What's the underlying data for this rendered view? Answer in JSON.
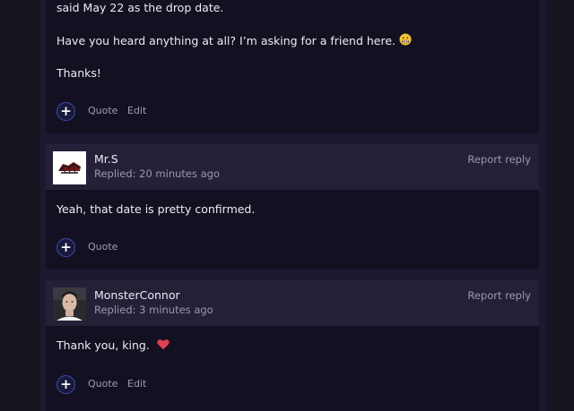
{
  "posts": [
    {
      "lines": [
        "said May 22 as the drop date.",
        "Have you heard anything at all? I’m asking for a friend here.",
        "Thanks!"
      ],
      "emoji_icon": "grimacing-face-icon",
      "actions": {
        "quote": "Quote",
        "edit": "Edit"
      }
    },
    {
      "username": "Mr.S",
      "replied": "Replied: 20 minutes ago",
      "report": "Report reply",
      "avatar_icon": "car-logo-avatar",
      "text": "Yeah, that date is pretty confirmed.",
      "actions": {
        "quote": "Quote"
      }
    },
    {
      "username": "MonsterConnor",
      "replied": "Replied: 3 minutes ago",
      "report": "Report reply",
      "avatar_icon": "user-photo-avatar",
      "text": "Thank you, king.",
      "emoji_icon": "red-heart-icon",
      "actions": {
        "quote": "Quote",
        "edit": "Edit"
      }
    }
  ],
  "colors": {
    "background": "#16141f",
    "column": "#1b1830",
    "post_body": "#131121",
    "post_header": "#251f38",
    "accent_button_border": "#3b4bb3",
    "muted_text": "#9c97ad",
    "heart": "#e0424f"
  }
}
